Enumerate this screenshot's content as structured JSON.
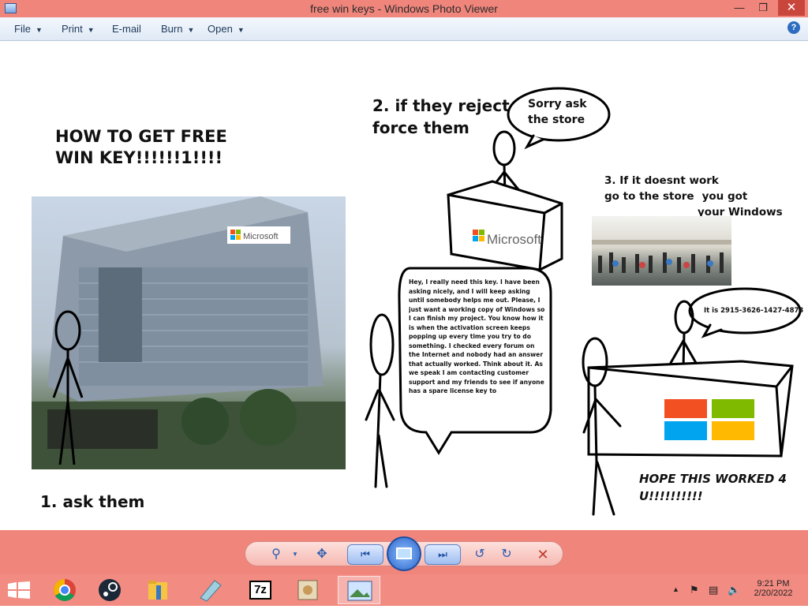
{
  "window": {
    "title": "free win keys - Windows Photo Viewer"
  },
  "menu": [
    {
      "label": "File",
      "has_dropdown": true
    },
    {
      "label": "Print",
      "has_dropdown": true
    },
    {
      "label": "E-mail",
      "has_dropdown": false
    },
    {
      "label": "Burn",
      "has_dropdown": true
    },
    {
      "label": "Open",
      "has_dropdown": true
    }
  ],
  "icons": {
    "help": "help-icon",
    "minimize": "minimize-icon",
    "maximize": "restore-icon",
    "close": "close-icon"
  },
  "image": {
    "heading": [
      "HOW TO GET FREE",
      "WIN KEY!!!!!!1!!!!"
    ],
    "step1": "1. ask them",
    "step2": [
      "2. if they reject",
      "force them"
    ],
    "bubble1": [
      "Sorry ask",
      "the store"
    ],
    "microsoft_label": "Microsoft",
    "building_sign": "Microsoft",
    "step3": [
      "3. If it doesnt work",
      "go to the store",
      "you got",
      "your Windows"
    ],
    "bubble_long": "Hey, I really need this key. I have been asking nicely, and I will keep asking until somebody helps me out. Please, I just want a working copy of Windows so I can finish my project. You know how it is when the activation screen keeps popping up every time you try to do something. I checked every forum on the Internet and nobody had an answer that actually worked. Think about it. As we speak I am contacting customer support and my friends to see if anyone has a spare license key to",
    "bubble_key": "It is 2915-3626-1427-4873",
    "ending": [
      "HOPE THIS WORKED 4",
      "U!!!!!!!!!!"
    ]
  },
  "controls": [
    "zoom-icon",
    "actual-size-icon",
    "previous-icon",
    "slideshow-icon",
    "next-icon",
    "rotate-ccw-icon",
    "rotate-cw-icon",
    "delete-icon"
  ],
  "taskbar": {
    "items": [
      "start-icon",
      "chrome-icon",
      "steam-icon",
      "file-explorer-icon",
      "pencil-app-icon",
      "7zip-icon",
      "photo-app-icon",
      "photo-viewer-icon"
    ],
    "time": "9:21 PM",
    "date": "2/20/2022"
  },
  "colors": {
    "chrome": "#f0857c",
    "taskbar": "#f28b82",
    "close": "#c9463d",
    "ms_red": "#f25022",
    "ms_green": "#7fba00",
    "ms_blue": "#00a4ef",
    "ms_yellow": "#ffb900"
  }
}
